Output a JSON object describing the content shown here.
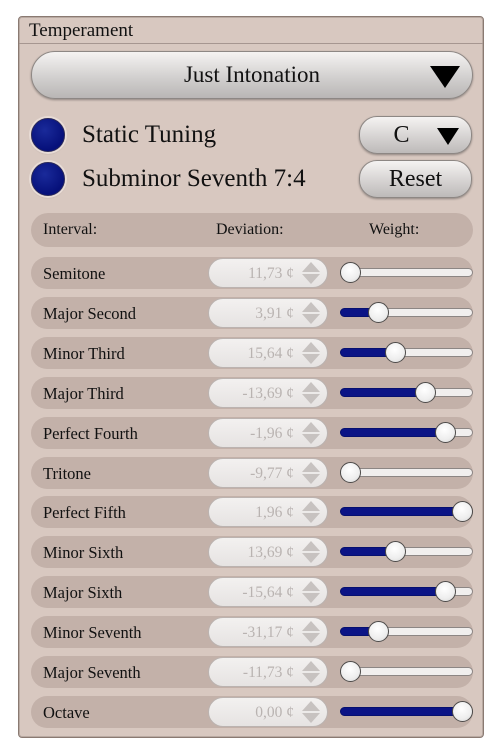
{
  "panel": {
    "title": "Temperament"
  },
  "temperament_select": {
    "value": "Just Intonation"
  },
  "options": [
    {
      "id": "static",
      "label": "Static Tuning"
    },
    {
      "id": "subminor",
      "label": "Subminor Seventh 7:4"
    }
  ],
  "key_select": {
    "value": "C"
  },
  "reset_button": {
    "label": "Reset"
  },
  "table": {
    "headers": {
      "interval": "Interval:",
      "deviation": "Deviation:",
      "weight": "Weight:"
    },
    "rows": [
      {
        "interval": "Semitone",
        "deviation": "11,73 ¢",
        "weight": 0.0
      },
      {
        "interval": "Major Second",
        "deviation": "3,91 ¢",
        "weight": 0.25
      },
      {
        "interval": "Minor Third",
        "deviation": "15,64 ¢",
        "weight": 0.4
      },
      {
        "interval": "Major Third",
        "deviation": "-13,69 ¢",
        "weight": 0.67
      },
      {
        "interval": "Perfect Fourth",
        "deviation": "-1,96 ¢",
        "weight": 0.85
      },
      {
        "interval": "Tritone",
        "deviation": "-9,77 ¢",
        "weight": 0.0
      },
      {
        "interval": "Perfect Fifth",
        "deviation": "1,96 ¢",
        "weight": 1.0
      },
      {
        "interval": "Minor Sixth",
        "deviation": "13,69 ¢",
        "weight": 0.4
      },
      {
        "interval": "Major Sixth",
        "deviation": "-15,64 ¢",
        "weight": 0.85
      },
      {
        "interval": "Minor Seventh",
        "deviation": "-31,17 ¢",
        "weight": 0.25
      },
      {
        "interval": "Major Seventh",
        "deviation": "-11,73 ¢",
        "weight": 0.0
      },
      {
        "interval": "Octave",
        "deviation": "0,00 ¢",
        "weight": 1.0
      }
    ]
  },
  "colors": {
    "panel_bg": "#d8c8c0",
    "row_bg": "#c3b1a9",
    "accent_blue": "#0b1486",
    "disabled_text": "#b9b3b1"
  },
  "icons": {
    "combo_arrow": "triangle-down-icon",
    "spin_arrows": "up-down-spinner-icon",
    "radio": "filled-circle-icon"
  }
}
